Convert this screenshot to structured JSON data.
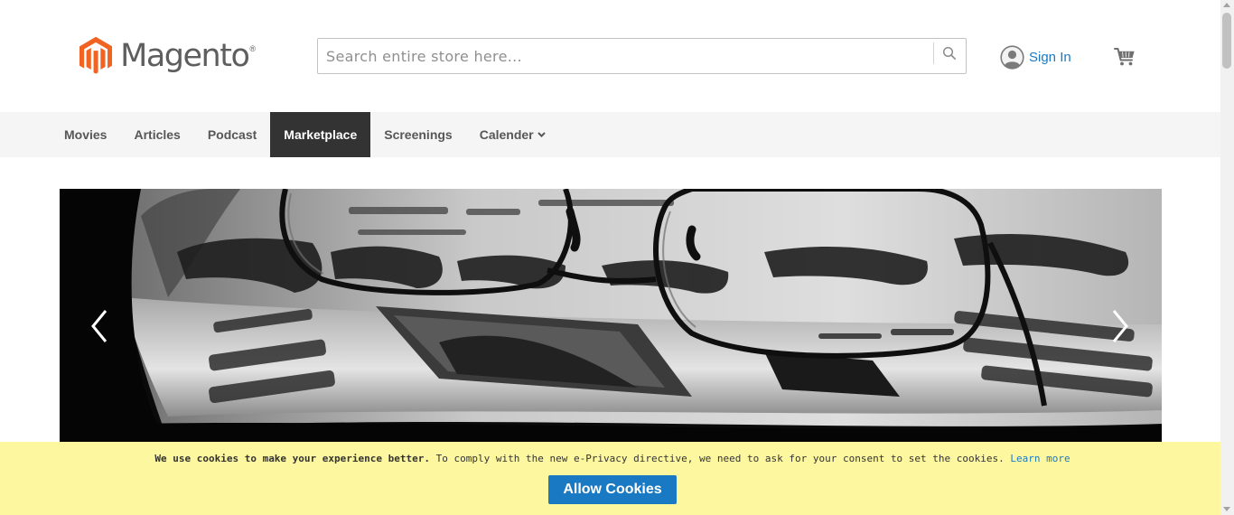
{
  "brand": {
    "logo_text": "Magento",
    "trademark": "®",
    "logo_color": "#f26322"
  },
  "search": {
    "placeholder": "Search entire store here...",
    "value": "",
    "icon": "search-icon"
  },
  "account": {
    "sign_in_label": "Sign In",
    "icon": "user-avatar-icon"
  },
  "cart": {
    "icon": "shopping-cart-icon"
  },
  "nav": {
    "items": [
      {
        "label": "Movies",
        "active": false
      },
      {
        "label": "Articles",
        "active": false
      },
      {
        "label": "Podcast",
        "active": false
      },
      {
        "label": "Marketplace",
        "active": true
      },
      {
        "label": "Screenings",
        "active": false
      },
      {
        "label": "Calender",
        "active": false,
        "has_dropdown": true
      }
    ]
  },
  "hero": {
    "image": "newspaper-with-glasses-photo",
    "prev_icon": "chevron-left-icon",
    "next_icon": "chevron-right-icon"
  },
  "cookie_notice": {
    "bold_text": "We use cookies to make your experience better.",
    "body_text": "To comply with the new e-Privacy directive, we need to ask for your consent to set the cookies.",
    "link_text": "Learn more",
    "button_label": "Allow Cookies",
    "background": "#fdf7a0",
    "button_color": "#1979c3"
  },
  "colors": {
    "link": "#1979c3",
    "nav_active_bg": "#333333",
    "nav_bg": "#f5f5f5"
  }
}
